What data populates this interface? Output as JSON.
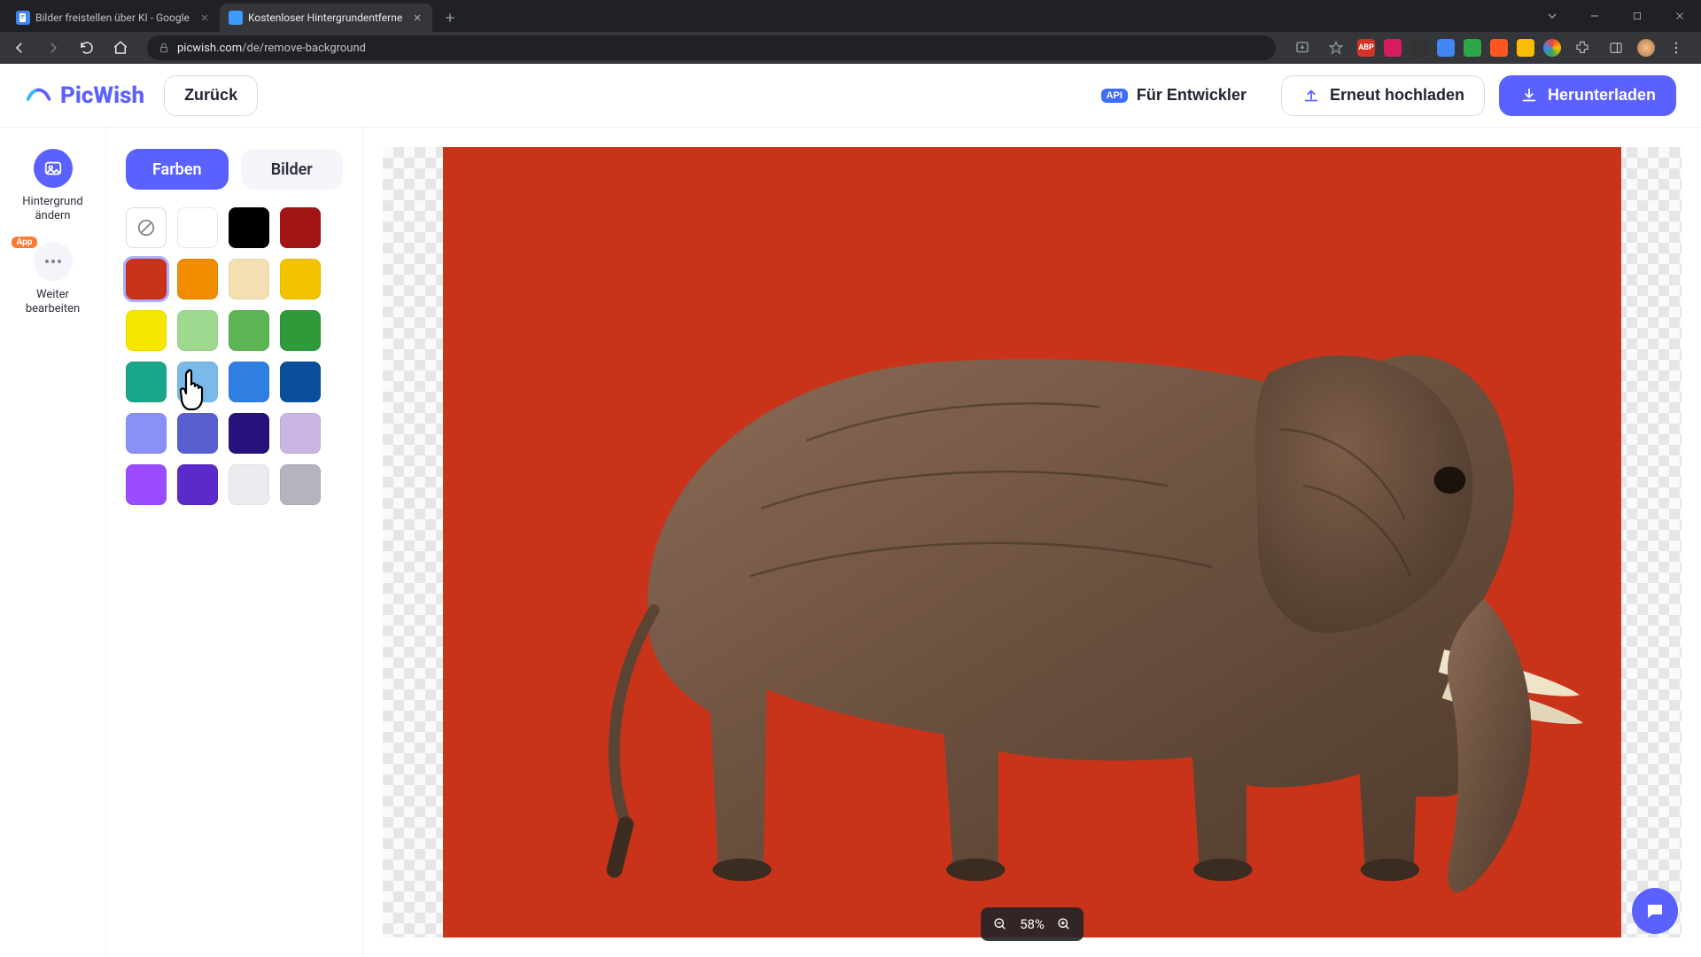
{
  "browser": {
    "tabs": [
      {
        "title": "Bilder freistellen über KI - Google",
        "favicon_bg": "#4285F4",
        "favicon_glyph": "",
        "active": false
      },
      {
        "title": "Kostenloser Hintergrundentferne",
        "favicon_bg": "#3b9bff",
        "favicon_glyph": "",
        "active": true
      }
    ],
    "url_domain": "picwish.com",
    "url_path": "/de/remove-background",
    "ext_icons": [
      {
        "bg": "#d93025",
        "fg": "#fff",
        "txt": "ABP"
      },
      {
        "bg": "#d81b60",
        "fg": "#fff",
        "txt": ""
      },
      {
        "bg": "#333",
        "fg": "#fff",
        "txt": ""
      },
      {
        "bg": "#4285f4",
        "fg": "#fff",
        "txt": ""
      },
      {
        "bg": "#2aa84a",
        "fg": "#fff",
        "txt": ""
      },
      {
        "bg": "#ff5722",
        "fg": "#fff",
        "txt": ""
      },
      {
        "bg": "#fbbc04",
        "fg": "#000",
        "txt": ""
      },
      {
        "bg": "conic",
        "fg": "",
        "txt": ""
      }
    ]
  },
  "header": {
    "logo_text": "PicWish",
    "back_label": "Zurück",
    "developers_label": "Für Entwickler",
    "api_pill": "API",
    "reupload_label": "Erneut hochladen",
    "download_label": "Herunterladen"
  },
  "rail": {
    "item1_label": "Hintergrund ändern",
    "item2_badge": "App",
    "item2_label": "Weiter bearbeiten"
  },
  "panel": {
    "tab_colors": "Farben",
    "tab_images": "Bilder",
    "colors": [
      "transparent",
      "#ffffff",
      "#000000",
      "#a21515",
      "#c9331a",
      "#f08c00",
      "#f4dfb3",
      "#f3c300",
      "#f7e600",
      "#9fd98f",
      "#5cb454",
      "#2f9a3a",
      "#1aa689",
      "#7ab9e8",
      "#2f7fe0",
      "#0a4f9c",
      "#8a90f5",
      "#5a5fd0",
      "#26127a",
      "#c9b6e4",
      "#9a4bff",
      "#5a2bc9",
      "#ececf0",
      "#b4b4bc"
    ],
    "selected_color_index": 4
  },
  "canvas": {
    "bg_color": "#c9331a",
    "zoom_label": "58%"
  }
}
